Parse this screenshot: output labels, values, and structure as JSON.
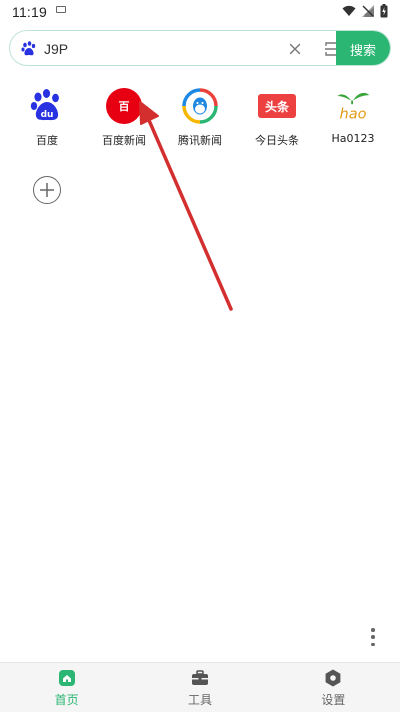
{
  "status": {
    "time": "11:19"
  },
  "search": {
    "value": "J9P",
    "button_label": "搜索"
  },
  "shortcuts": [
    {
      "label": "百度",
      "icon": "baidu-logo-icon"
    },
    {
      "label": "百度新闻",
      "icon": "baidu-news-icon",
      "icon_text": "百"
    },
    {
      "label": "腾讯新闻",
      "icon": "tencent-news-icon"
    },
    {
      "label": "今日头条",
      "icon": "toutiao-icon",
      "icon_text": "头条"
    },
    {
      "label": "Ha0123",
      "icon": "hao123-icon",
      "icon_text": "hao"
    }
  ],
  "bottom_nav": [
    {
      "label": "首页",
      "icon": "home-icon",
      "active": true
    },
    {
      "label": "工具",
      "icon": "toolbox-icon",
      "active": false
    },
    {
      "label": "设置",
      "icon": "settings-icon",
      "active": false
    }
  ],
  "colors": {
    "accent": "#2bb673",
    "baidu_blue": "#2932e1",
    "baidu_news_red": "#e60012",
    "toutiao_red": "#ed4040",
    "arrow_red": "#d32f2f"
  }
}
